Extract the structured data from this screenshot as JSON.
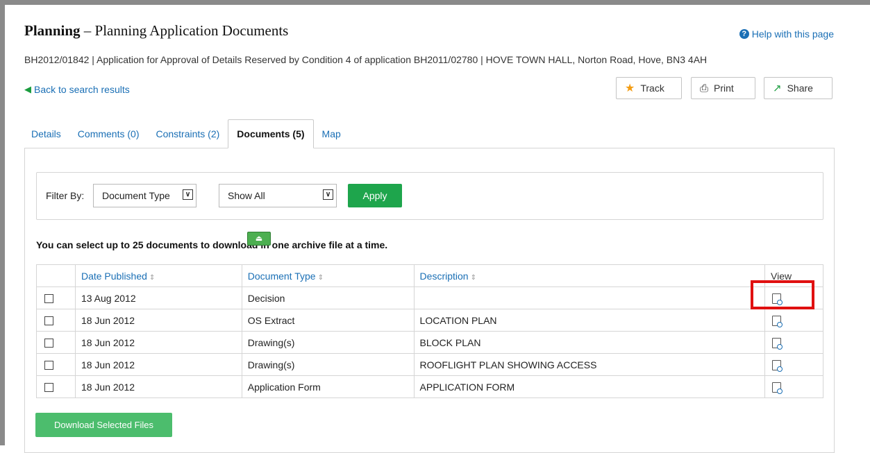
{
  "header": {
    "title_bold": "Planning",
    "title_rest": " – Planning Application Documents",
    "help_label": "Help with this page",
    "subtitle": "BH2012/01842 | Application for Approval of Details Reserved by Condition 4 of application BH2011/02780 | HOVE TOWN HALL, Norton Road, Hove, BN3 4AH"
  },
  "nav": {
    "back_label": "Back to search results"
  },
  "actions": {
    "track": "Track",
    "print": "Print",
    "share": "Share"
  },
  "tabs": [
    {
      "label": "Details"
    },
    {
      "label": "Comments (0)"
    },
    {
      "label": "Constraints (2)"
    },
    {
      "label": "Documents (5)",
      "active": true
    },
    {
      "label": "Map"
    }
  ],
  "filter": {
    "label": "Filter By:",
    "type_value": "Document Type",
    "show_value": "Show All",
    "apply_label": "Apply"
  },
  "note": "You can select up to 25 documents to download in one archive file at a time.",
  "table": {
    "headers": [
      "Date Published",
      "Document Type",
      "Description",
      "View"
    ],
    "rows": [
      {
        "date": "13 Aug 2012",
        "type": "Decision",
        "description": ""
      },
      {
        "date": "18 Jun 2012",
        "type": "OS Extract",
        "description": "LOCATION PLAN"
      },
      {
        "date": "18 Jun 2012",
        "type": "Drawing(s)",
        "description": "BLOCK PLAN"
      },
      {
        "date": "18 Jun 2012",
        "type": "Drawing(s)",
        "description": "ROOFLIGHT PLAN SHOWING ACCESS"
      },
      {
        "date": "18 Jun 2012",
        "type": "Application Form",
        "description": "APPLICATION FORM"
      }
    ]
  },
  "download_label": "Download Selected Files",
  "colors": {
    "link": "#1a6fb5",
    "green": "#1ea54c",
    "highlight": "#e01010",
    "star": "#f39c12"
  }
}
